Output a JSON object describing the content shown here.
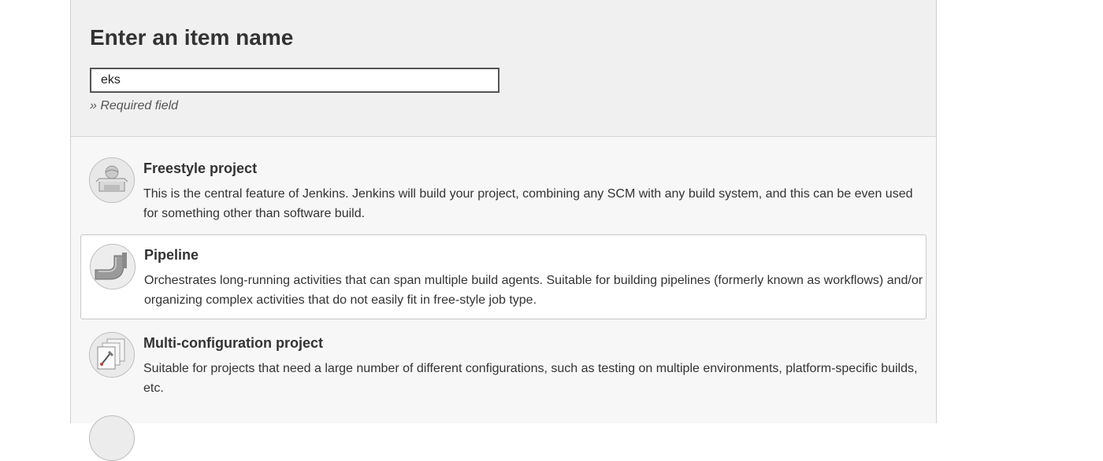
{
  "form": {
    "title": "Enter an item name",
    "item_name_value": "eks",
    "required_note": "» Required field"
  },
  "item_types": [
    {
      "name": "Freestyle project",
      "description": "This is the central feature of Jenkins. Jenkins will build your project, combining any SCM with any build system, and this can be even used for something other than software build.",
      "icon": "freestyle-project-icon",
      "selected": false
    },
    {
      "name": "Pipeline",
      "description": "Orchestrates long-running activities that can span multiple build agents. Suitable for building pipelines (formerly known as workflows) and/or organizing complex activities that do not easily fit in free-style job type.",
      "icon": "pipeline-icon",
      "selected": true
    },
    {
      "name": "Multi-configuration project",
      "description": "Suitable for projects that need a large number of different configurations, such as testing on multiple environments, platform-specific builds, etc.",
      "icon": "multi-configuration-icon",
      "selected": false
    }
  ]
}
